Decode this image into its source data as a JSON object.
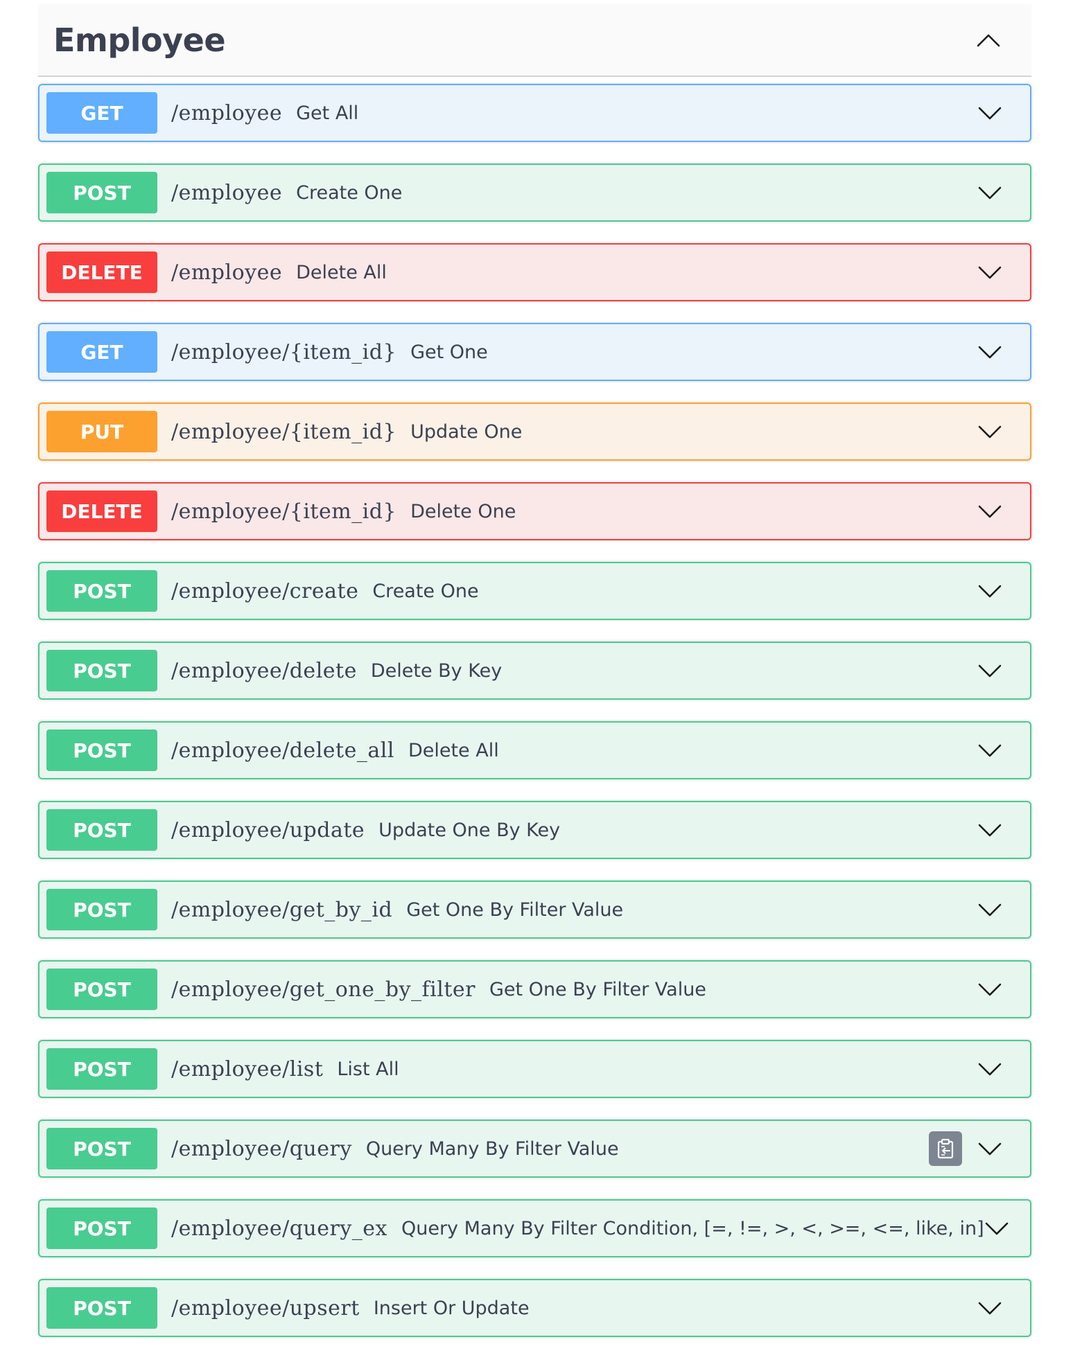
{
  "section": {
    "title": "Employee"
  },
  "operations": [
    {
      "method": "GET",
      "path": "/employee",
      "summary": "Get All"
    },
    {
      "method": "POST",
      "path": "/employee",
      "summary": "Create One"
    },
    {
      "method": "DELETE",
      "path": "/employee",
      "summary": "Delete All"
    },
    {
      "method": "GET",
      "path": "/employee/{item_id}",
      "summary": "Get One"
    },
    {
      "method": "PUT",
      "path": "/employee/{item_id}",
      "summary": "Update One"
    },
    {
      "method": "DELETE",
      "path": "/employee/{item_id}",
      "summary": "Delete One"
    },
    {
      "method": "POST",
      "path": "/employee/create",
      "summary": "Create One"
    },
    {
      "method": "POST",
      "path": "/employee/delete",
      "summary": "Delete By Key"
    },
    {
      "method": "POST",
      "path": "/employee/delete_all",
      "summary": "Delete All"
    },
    {
      "method": "POST",
      "path": "/employee/update",
      "summary": "Update One By Key"
    },
    {
      "method": "POST",
      "path": "/employee/get_by_id",
      "summary": "Get One By Filter Value"
    },
    {
      "method": "POST",
      "path": "/employee/get_one_by_filter",
      "summary": "Get One By Filter Value"
    },
    {
      "method": "POST",
      "path": "/employee/list",
      "summary": "List All"
    },
    {
      "method": "POST",
      "path": "/employee/query",
      "summary": "Query Many By Filter Value",
      "copy_icon": "clipboard-copy-icon"
    },
    {
      "method": "POST",
      "path": "/employee/query_ex",
      "summary": "Query Many By Filter Condition, [=, !=, >, <, >=, <=, like, in]"
    },
    {
      "method": "POST",
      "path": "/employee/upsert",
      "summary": "Insert Or Update"
    }
  ],
  "colors": {
    "get": "#61affe",
    "post": "#49cc90",
    "delete": "#f93e3e",
    "put": "#fca130",
    "text": "#3b4151"
  }
}
